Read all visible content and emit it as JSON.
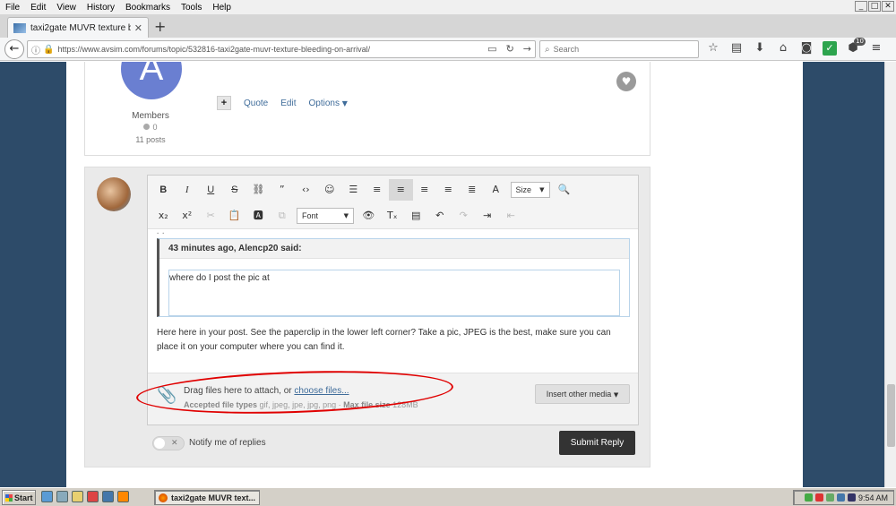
{
  "menu": [
    "File",
    "Edit",
    "View",
    "History",
    "Bookmarks",
    "Tools",
    "Help"
  ],
  "window_controls": {
    "minimize": "_",
    "maximize": "□",
    "close": "✕"
  },
  "tab": {
    "title": "taxi2gate MUVR texture blee...",
    "close": "✕",
    "new_tab": "+"
  },
  "nav": {
    "url": "https://www.avsim.com/forums/topic/532816-taxi2gate-muvr-texture-bleeding-on-arrival/",
    "search_placeholder": "Search",
    "badge_count": "10"
  },
  "post": {
    "avatar_letter": "A",
    "role": "Members",
    "reputation": "0",
    "post_count": "11 posts",
    "actions": {
      "quote": "Quote",
      "edit": "Edit",
      "options": "Options"
    }
  },
  "editor": {
    "toolbar_row1": [
      "B",
      "I",
      "U",
      "S",
      "link-icon",
      "quote-icon",
      "code-icon",
      "emoji-icon",
      "bulleted-list-icon",
      "numbered-list-icon",
      "align-left-icon",
      "align-center-icon",
      "align-right-icon",
      "justify-icon",
      "text-color-icon"
    ],
    "size_label": "Size",
    "font_label": "Font",
    "quote_header": "43 minutes ago, Alencp20 said:",
    "quote_body": "where do I post the pic at",
    "reply_text": "Here here in your post.  See the paperclip in the lower left corner?  Take a pic,  JPEG is the best, make sure you can place it on your computer where you can find it."
  },
  "attachments": {
    "drag_text": "Drag files here to attach, or ",
    "choose_link": "choose files...",
    "accepted_label": "Accepted file types",
    "accepted_types": "gif, jpeg, jpe, jpg, png",
    "separator": " · ",
    "max_label": "Max file size",
    "max_size": "128MB",
    "insert_media": "Insert other media"
  },
  "footer": {
    "notify": "Notify me of replies",
    "submit": "Submit Reply"
  },
  "taskbar": {
    "start": "Start",
    "task_title": "taxi2gate MUVR text...",
    "clock": "9:54 AM"
  },
  "colors": {
    "accent_link": "#3f6c9a",
    "page_bg": "#2d4b69",
    "annotation": "#e00000",
    "avatar": "#6a7fd1"
  }
}
